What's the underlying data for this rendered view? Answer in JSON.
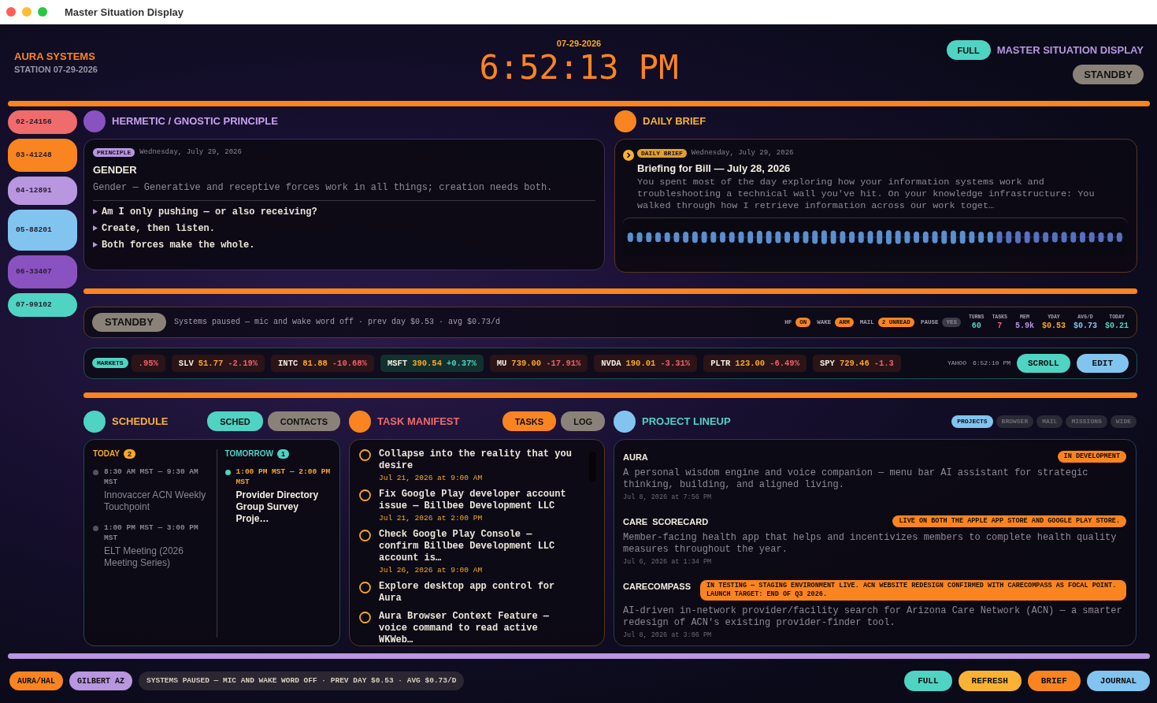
{
  "window": {
    "title": "Master Situation Display"
  },
  "header": {
    "brand": "AURA SYSTEMS",
    "station": "STATION 07-29-2026",
    "date": "07-29-2026",
    "clock": "6:52:13 PM",
    "display_title": "MASTER SITUATION DISPLAY",
    "full_button": "FULL",
    "standby_button": "STANDBY"
  },
  "sidebar": {
    "items": [
      {
        "label": "02-24156",
        "color": "#f06b6b",
        "kind": "short"
      },
      {
        "label": "03-41248",
        "color": "#fa8420",
        "kind": "tall"
      },
      {
        "label": "04-12891",
        "color": "#b896e0",
        "kind": "medium"
      },
      {
        "label": "05-88201",
        "color": "#82c4f0",
        "kind": "large"
      },
      {
        "label": "06-33407",
        "color": "#8a52c0",
        "kind": "tall"
      },
      {
        "label": "07-99102",
        "color": "#4fd3c2",
        "kind": "short"
      }
    ]
  },
  "principle": {
    "title": "HERMETIC / GNOSTIC PRINCIPLE",
    "badge": "PRINCIPLE",
    "date": "Wednesday, July 29, 2026",
    "heading": "GENDER",
    "summary": "Gender — Generative and receptive forces work in all things; creation needs both.",
    "points": [
      "Am I only pushing — or also receiving?",
      "Create, then listen.",
      "Both forces make the whole."
    ]
  },
  "brief": {
    "title": "DAILY BRIEF",
    "badge": "DAILY BRIEF",
    "date": "Wednesday, July 29, 2026",
    "heading": "Briefing for Bill — July 28, 2026",
    "body": "You spent most of the day exploring how your information systems work and troubleshooting a technical wall you've hit. On your knowledge infrastructure: You walked through how I retrieve information across our work toget…"
  },
  "status": {
    "mode": "STANDBY",
    "message": "Systems paused — mic and wake word off · prev day $0.53 · avg $0.73/d",
    "flags": [
      {
        "label": "HF",
        "value": "ON",
        "active": true
      },
      {
        "label": "WAKE",
        "value": "ARM",
        "active": true
      },
      {
        "label": "MAIL",
        "value": "2 UNREAD",
        "active": true
      },
      {
        "label": "PAUSE",
        "value": "YES",
        "active": false
      }
    ],
    "stats": [
      {
        "label": "TURNS",
        "value": "60",
        "color": "#4fd3c2"
      },
      {
        "label": "TASKS",
        "value": "7",
        "color": "#f06b6b"
      },
      {
        "label": "MEM",
        "value": "5.9k",
        "color": "#b896e0"
      },
      {
        "label": "YDAY",
        "value": "$0.53",
        "color": "#f9a825"
      },
      {
        "label": "AVG/D",
        "value": "$0.73",
        "color": "#82c4f0"
      },
      {
        "label": "TODAY",
        "value": "$0.21",
        "color": "#4fd3c2"
      }
    ]
  },
  "markets": {
    "label": "MARKETS",
    "tickers": [
      {
        "change": ".95%",
        "up": false
      },
      {
        "symbol": "SLV",
        "price": "51.77",
        "change": "-2.19%",
        "up": false
      },
      {
        "symbol": "INTC",
        "price": "81.88",
        "change": "-10.68%",
        "up": false
      },
      {
        "symbol": "MSFT",
        "price": "390.54",
        "change": "+0.37%",
        "up": true
      },
      {
        "symbol": "MU",
        "price": "739.00",
        "change": "-17.91%",
        "up": false
      },
      {
        "symbol": "NVDA",
        "price": "190.01",
        "change": "-3.31%",
        "up": false
      },
      {
        "symbol": "PLTR",
        "price": "123.00",
        "change": "-6.49%",
        "up": false
      },
      {
        "symbol": "SPY",
        "price": "729.46",
        "change": "-1.3",
        "up": false
      }
    ],
    "source": "YAHOO",
    "time": "6:52:10 PM",
    "scroll_button": "SCROLL",
    "edit_button": "EDIT"
  },
  "schedule": {
    "title": "SCHEDULE",
    "tabs": [
      {
        "label": "SCHED",
        "selected": true
      },
      {
        "label": "CONTACTS",
        "selected": false
      }
    ],
    "days": [
      {
        "label": "TODAY",
        "count": "2",
        "color": "#f9a825",
        "events": [
          {
            "time": "8:30 AM MST — 9:30 AM MST",
            "title": "Innovaccer ACN Weekly Touchpoint",
            "past": true
          },
          {
            "time": "1:00 PM MST — 3:00 PM MST",
            "title": "ELT Meeting (2026 Meeting Series)",
            "past": true
          }
        ]
      },
      {
        "label": "TOMORROW",
        "count": "1",
        "color": "#4fd3c2",
        "events": [
          {
            "time": "1:00 PM MST — 2:00 PM MST",
            "title": "Provider Directory Group Survey Proje…",
            "past": false
          }
        ]
      }
    ]
  },
  "tasks": {
    "title": "TASK MANIFEST",
    "tabs": [
      {
        "label": "TASKS",
        "selected": true
      },
      {
        "label": "LOG",
        "selected": false
      }
    ],
    "items": [
      {
        "title": "Collapse into the reality that you desire",
        "due": "Jul 21, 2026 at 9:00 AM"
      },
      {
        "title": "Fix Google Play developer account issue — Billbee Development LLC",
        "due": "Jul 21, 2026 at 2:00 PM"
      },
      {
        "title": "Check Google Play Console — confirm Billbee Development LLC account is…",
        "due": "Jul 26, 2026 at 9:00 AM"
      },
      {
        "title": "Explore desktop app control for Aura"
      },
      {
        "title": "Aura Browser Context Feature — voice command to read active WKWeb…"
      }
    ]
  },
  "projects": {
    "title": "PROJECT LINEUP",
    "tabs": [
      {
        "label": "PROJECTS",
        "selected": true
      },
      {
        "label": "BROWSER",
        "selected": false
      },
      {
        "label": "MAIL",
        "selected": false
      },
      {
        "label": "MISSIONS",
        "selected": false
      },
      {
        "label": "WIDE",
        "selected": false
      }
    ],
    "items": [
      {
        "name": "AURA",
        "status": "IN DEVELOPMENT",
        "description": "A personal wisdom engine and voice companion — menu bar AI assistant for strategic thinking, building, and aligned living.",
        "date": "Jul 8, 2026 at 7:56 PM"
      },
      {
        "name": "CARE SCORECARD",
        "status": "LIVE ON BOTH THE APPLE APP STORE AND GOOGLE PLAY STORE.",
        "description": "Member-facing health app that helps and incentivizes members to complete health quality measures throughout the year.",
        "date": "Jul 6, 2026 at 1:34 PM"
      },
      {
        "name": "CARECOMPASS",
        "status": "IN TESTING — STAGING ENVIRONMENT LIVE. ACN WEBSITE REDESIGN CONFIRMED WITH CARECOMPASS AS FOCAL POINT. LAUNCH TARGET: END OF Q3 2026.",
        "description": "AI-driven in-network provider/facility search for Arizona Care Network (ACN) — a smarter redesign of ACN's existing provider-finder tool.",
        "date": "Jul 8, 2026 at 3:06 PM"
      }
    ]
  },
  "footer": {
    "tags": [
      {
        "label": "AURA/HAL",
        "color": "#fa8420"
      },
      {
        "label": "GILBERT AZ",
        "color": "#b896e0"
      }
    ],
    "message": "SYSTEMS PAUSED — MIC AND WAKE WORD OFF · PREV DAY $0.53 · AVG $0.73/D",
    "buttons": [
      {
        "label": "FULL",
        "color": "#4fd3c2"
      },
      {
        "label": "REFRESH",
        "color": "#f9b233"
      },
      {
        "label": "BRIEF",
        "color": "#fa8420"
      },
      {
        "label": "JOURNAL",
        "color": "#82c4f0"
      }
    ]
  }
}
